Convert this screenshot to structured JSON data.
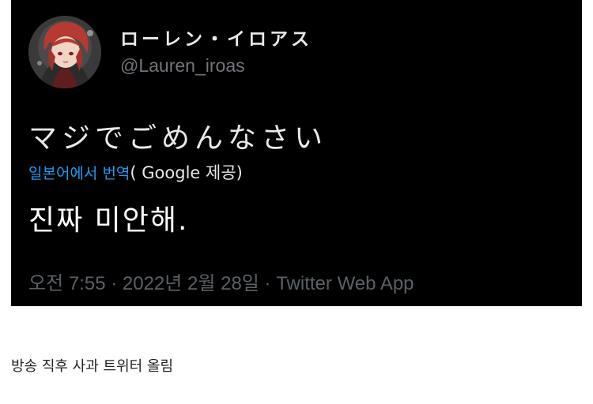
{
  "tweet": {
    "display_name": "ローレン・イロアス",
    "handle": "@Lauren_iroas",
    "text": "マジでごめんなさい",
    "translate_label": "일본어에서 번역",
    "translate_provider": "( Google 제공)",
    "translated_text": "진짜 미안해.",
    "time": "오전 7:55",
    "separator_1": " · ",
    "date": "2022년 2월 28일",
    "separator_2": " · ",
    "source": "Twitter Web App"
  },
  "caption": "방송 직후 사과 트위터 올림",
  "colors": {
    "card_background": "#000000",
    "link": "#1d9bf0",
    "secondary_text": "#71767b",
    "primary_text": "#e7e9ea"
  },
  "icons": {
    "avatar": "profile-avatar-red-haired-character"
  }
}
